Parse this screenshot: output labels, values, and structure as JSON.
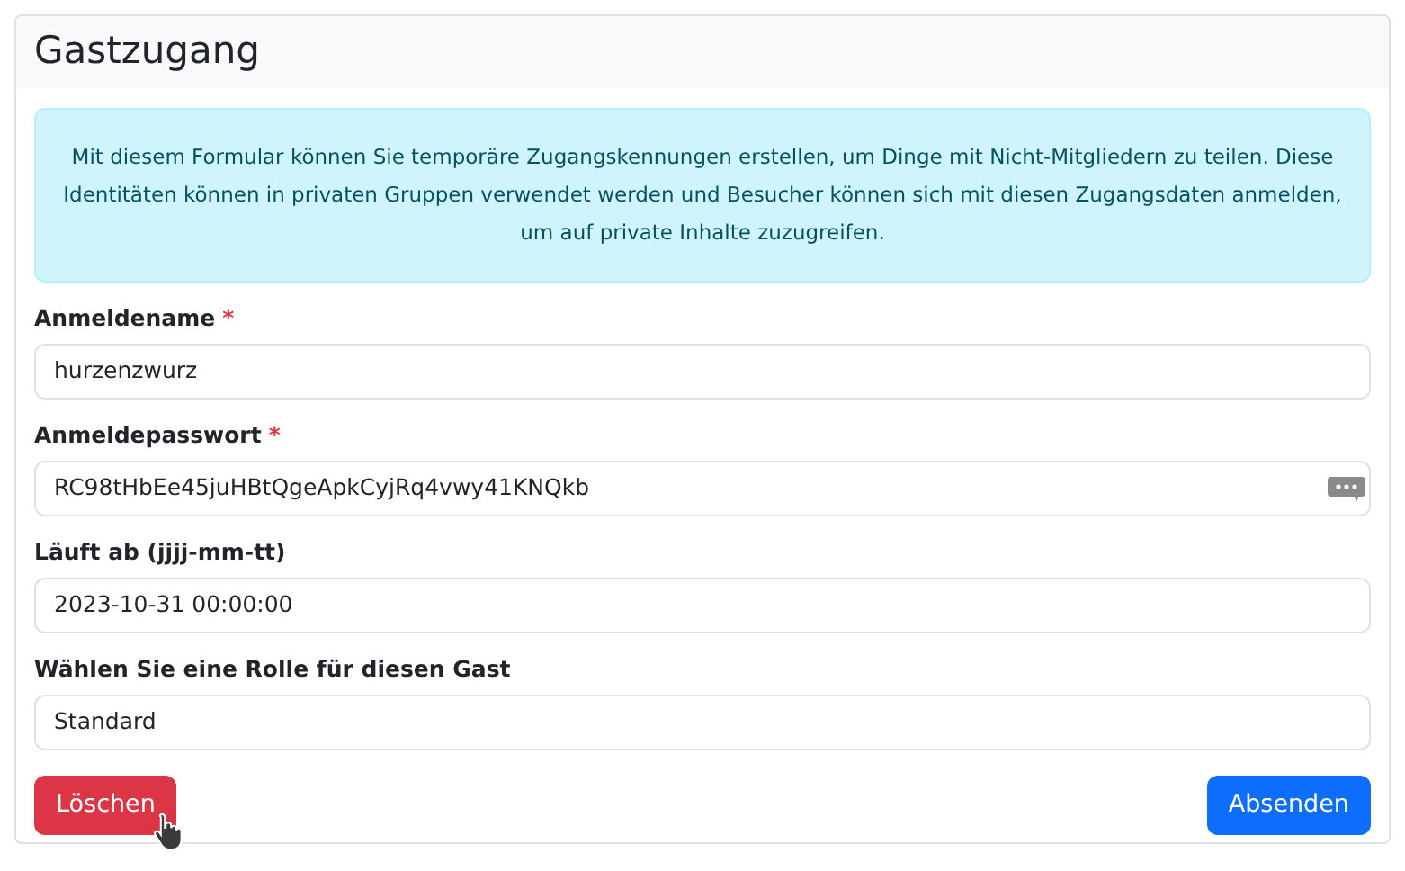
{
  "card": {
    "title": "Gastzugang"
  },
  "info": "Mit diesem Formular können Sie temporäre Zugangskennungen erstellen, um Dinge mit Nicht-Mitgliedern zu teilen. Diese Identitäten können in privaten Gruppen verwendet werden und Besucher können sich mit diesen Zugangsdaten anmelden, um auf private Inhalte zuzugreifen.",
  "fields": [
    {
      "label": "Anmeldename",
      "required_mark": "*",
      "value": "hurzenzwurz",
      "password_manager": false
    },
    {
      "label": "Anmeldepasswort",
      "required_mark": "*",
      "value": "RC98tHbEe45juHBtQgeApkCyjRq4vwy41KNQkb",
      "password_manager": true
    },
    {
      "label": "Läuft ab (jjjj-mm-tt)",
      "value": "2023-10-31 00:00:00",
      "password_manager": false
    },
    {
      "label": "Wählen Sie eine Rolle für diesen Gast",
      "value": "Standard",
      "password_manager": false
    }
  ],
  "buttons": [
    {
      "label": "Löschen",
      "kind": "danger",
      "hovered": true
    },
    {
      "label": "Absenden",
      "kind": "primary",
      "hovered": false
    }
  ]
}
